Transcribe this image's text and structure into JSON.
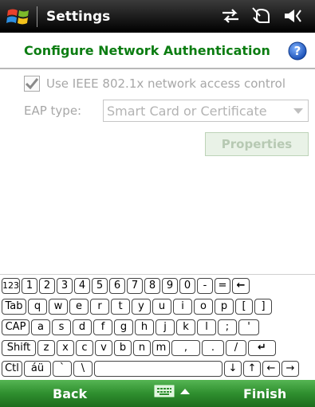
{
  "titlebar": {
    "title": "Settings",
    "icons": [
      "windows-start-icon",
      "data-connection-icon",
      "phone-off-icon",
      "speaker-icon"
    ]
  },
  "subtitle": {
    "text": "Configure Network Authentication",
    "help_icon": "help-icon"
  },
  "form": {
    "ieee_checkbox_label": "Use IEEE 802.1x network access control",
    "ieee_checked": true,
    "eap_label": "EAP type:",
    "eap_value": "Smart Card or Certificate",
    "properties_label": "Properties"
  },
  "keyboard": {
    "row1": [
      "123",
      "1",
      "2",
      "3",
      "4",
      "5",
      "6",
      "7",
      "8",
      "9",
      "0",
      "-",
      "=",
      "←"
    ],
    "row2": [
      "Tab",
      "q",
      "w",
      "e",
      "r",
      "t",
      "y",
      "u",
      "i",
      "o",
      "p",
      "[",
      "]"
    ],
    "row3": [
      "CAP",
      "a",
      "s",
      "d",
      "f",
      "g",
      "h",
      "j",
      "k",
      "l",
      ";",
      "'"
    ],
    "row4": [
      "Shift",
      "z",
      "x",
      "c",
      "v",
      "b",
      "n",
      "m",
      ",",
      ".",
      "/",
      "↵"
    ],
    "row5": [
      "Ctl",
      "áü",
      "`",
      "\\",
      "",
      "↓",
      "↑",
      "←",
      "→"
    ]
  },
  "menubar": {
    "left": "Back",
    "right": "Finish",
    "sip_icon": "keyboard-icon"
  },
  "colors": {
    "accent_green": "#0c7d12",
    "menubar_green": "#2f8f2f",
    "help_blue": "#2266cc"
  }
}
